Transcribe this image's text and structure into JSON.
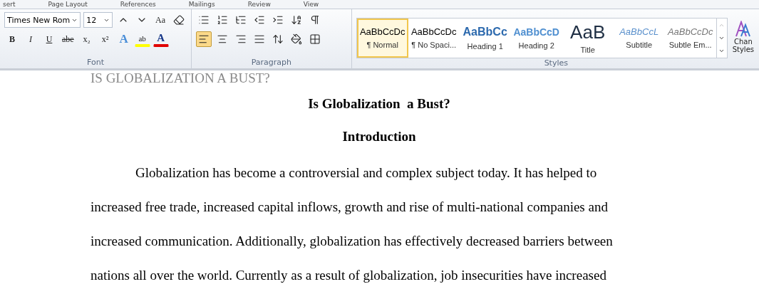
{
  "ribbon_tabs": [
    "sert",
    "Page Layout",
    "References",
    "Mailings",
    "Review",
    "View"
  ],
  "font_group": {
    "label": "Font",
    "font_name": "Times New Rom",
    "font_size": "12",
    "change_case": "Aa",
    "row2": [
      {
        "kind": "bold",
        "text": "B"
      },
      {
        "kind": "italic",
        "text": "I"
      },
      {
        "kind": "underline",
        "text": "U"
      },
      {
        "kind": "strike",
        "text": "abe"
      },
      {
        "kind": "sub",
        "text": "x₂"
      },
      {
        "kind": "sup",
        "text": "x²"
      }
    ],
    "effects": "A",
    "highlight": "ab",
    "font_color": "A"
  },
  "paragraph_group": {
    "label": "Paragraph",
    "alignments": [
      {
        "kind": "left",
        "selected": true
      },
      {
        "kind": "center",
        "selected": false
      },
      {
        "kind": "right",
        "selected": false
      },
      {
        "kind": "justify",
        "selected": false
      }
    ]
  },
  "styles_group": {
    "label": "Styles",
    "styles": [
      {
        "sample": "AaBbCcDc",
        "name": "¶ Normal",
        "kind": "normal",
        "selected": true
      },
      {
        "sample": "AaBbCcDc",
        "name": "¶ No Spaci...",
        "kind": "normal",
        "selected": false
      },
      {
        "sample": "AaBbCc",
        "name": "Heading 1",
        "kind": "h1",
        "selected": false
      },
      {
        "sample": "AaBbCcD",
        "name": "Heading 2",
        "kind": "h2",
        "selected": false
      },
      {
        "sample": "AaB",
        "name": "Title",
        "kind": "title",
        "selected": false
      },
      {
        "sample": "AaBbCcL",
        "name": "Subtitle",
        "kind": "subtitle",
        "selected": false
      },
      {
        "sample": "AaBbCcDc",
        "name": "Subtle Em...",
        "kind": "subtle",
        "selected": false
      }
    ]
  },
  "change_styles": [
    "Chan",
    "Styles"
  ],
  "document": {
    "running_head": "IS GLOBALIZATION A BUST?",
    "title": "Is Globalization  a Bust?",
    "heading": "Introduction",
    "paragraph_lines": [
      "Globalization has become a controversial and complex subject today. It has helped to",
      "increased free trade, increased capital inflows, growth and rise of multi-national companies and",
      "increased communication. Additionally, globalization has effectively decreased barriers between",
      "nations all over the world. Currently as a result of globalization, job insecurities have increased"
    ]
  }
}
